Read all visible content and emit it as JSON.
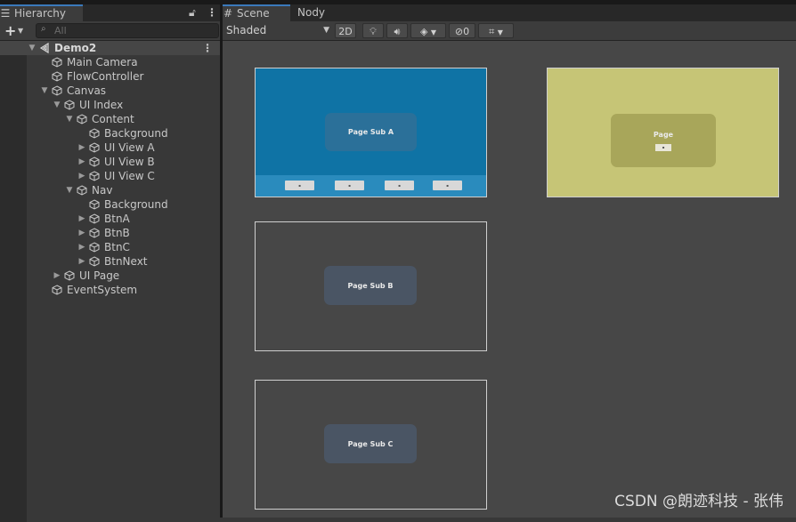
{
  "hierarchy": {
    "tab_label": "Hierarchy",
    "tab_icon": "list-icon",
    "add_label": "+",
    "search_placeholder": "All",
    "rows": [
      {
        "label": "Demo2",
        "depth": 0,
        "arrow": "▼",
        "icon": "unity-scene-icon",
        "scene": true
      },
      {
        "label": "Main Camera",
        "depth": 1,
        "arrow": "",
        "icon": "cube-icon"
      },
      {
        "label": "FlowController",
        "depth": 1,
        "arrow": "",
        "icon": "cube-icon"
      },
      {
        "label": "Canvas",
        "depth": 1,
        "arrow": "▼",
        "icon": "cube-icon"
      },
      {
        "label": "UI Index",
        "depth": 2,
        "arrow": "▼",
        "icon": "cube-icon"
      },
      {
        "label": "Content",
        "depth": 3,
        "arrow": "▼",
        "icon": "cube-icon"
      },
      {
        "label": "Background",
        "depth": 4,
        "arrow": "",
        "icon": "cube-icon"
      },
      {
        "label": "UI View A",
        "depth": 4,
        "arrow": "▶",
        "icon": "cube-icon"
      },
      {
        "label": "UI View B",
        "depth": 4,
        "arrow": "▶",
        "icon": "cube-icon"
      },
      {
        "label": "UI View C",
        "depth": 4,
        "arrow": "▶",
        "icon": "cube-icon"
      },
      {
        "label": "Nav",
        "depth": 3,
        "arrow": "▼",
        "icon": "cube-icon"
      },
      {
        "label": "Background",
        "depth": 4,
        "arrow": "",
        "icon": "cube-icon"
      },
      {
        "label": "BtnA",
        "depth": 4,
        "arrow": "▶",
        "icon": "cube-icon"
      },
      {
        "label": "BtnB",
        "depth": 4,
        "arrow": "▶",
        "icon": "cube-icon"
      },
      {
        "label": "BtnC",
        "depth": 4,
        "arrow": "▶",
        "icon": "cube-icon"
      },
      {
        "label": "BtnNext",
        "depth": 4,
        "arrow": "▶",
        "icon": "cube-icon"
      },
      {
        "label": "UI Page",
        "depth": 2,
        "arrow": "▶",
        "icon": "cube-icon"
      },
      {
        "label": "EventSystem",
        "depth": 1,
        "arrow": "",
        "icon": "cube-icon"
      }
    ]
  },
  "scene": {
    "tab_scene": "Scene",
    "tab_nody": "Nody",
    "shading_mode": "Shaded",
    "btn_2d": "2D",
    "hidden_count": "0",
    "views": {
      "sub_a": {
        "label": "Page Sub A",
        "bg": "#0f73a5",
        "panel": "#2b7099"
      },
      "page": {
        "label": "Page",
        "bg": "#c6c576",
        "panel": "#a8a65a"
      },
      "sub_b": {
        "label": "Page Sub B",
        "bg": "#474747",
        "panel": "#4a5564"
      },
      "sub_c": {
        "label": "Page Sub C",
        "bg": "#474747",
        "panel": "#4a5564"
      }
    }
  },
  "watermark": "CSDN @朗迹科技 - 张伟"
}
